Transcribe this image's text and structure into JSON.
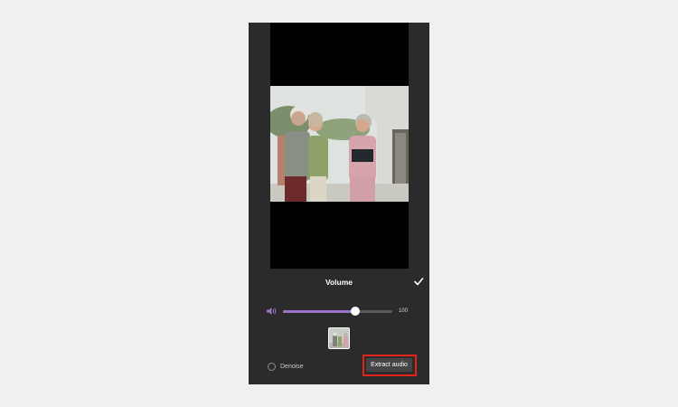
{
  "panel": {
    "title": "Volume",
    "confirm_icon": "checkmark-icon"
  },
  "volume": {
    "icon": "speaker-icon",
    "value": 100,
    "value_label": "100",
    "fill_fraction": 0.66
  },
  "denoise": {
    "label": "Denoise",
    "checked": false
  },
  "extract": {
    "label": "Extract audio",
    "highlight_color": "#e1251b"
  },
  "colors": {
    "accent": "#9b74c9",
    "panel_bg": "#2b2b2b"
  }
}
